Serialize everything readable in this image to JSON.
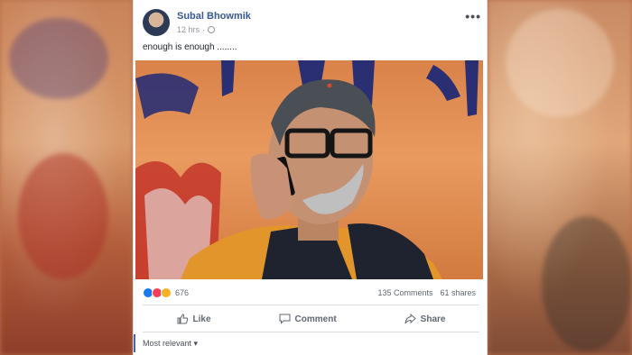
{
  "post": {
    "author": "Subal Bhowmik",
    "timestamp": "12 hrs",
    "privacy_icon": "globe-icon",
    "menu_icon": "more-options-icon",
    "text": "enough is enough ........",
    "reaction_count": "676",
    "reaction_icons": [
      "like-icon",
      "love-icon",
      "haha-icon"
    ],
    "comments": "135 Comments",
    "shares": "61 shares"
  },
  "actions": {
    "like": "Like",
    "comment": "Comment",
    "share": "Share"
  },
  "comments_section": {
    "sort_label": "Most relevant",
    "sort_arrow": "▾"
  },
  "colors": {
    "link_blue": "#385898",
    "like_blue": "#1877f2",
    "love_red": "#f33e58",
    "haha_yellow": "#f7b125"
  }
}
